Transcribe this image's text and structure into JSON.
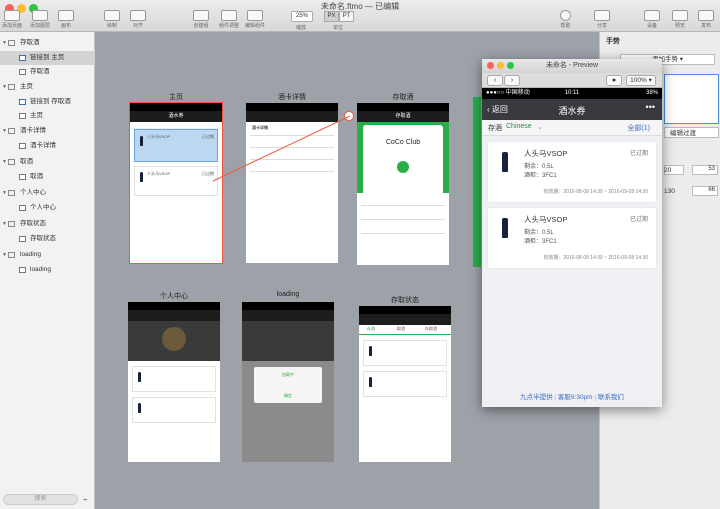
{
  "window": {
    "title": "未命名.ftmo — 已编辑"
  },
  "toolbar": {
    "items": [
      "添加页面",
      "添加图层",
      "画布",
      "绘制",
      "对齐",
      "创建组",
      "组件调整",
      "编辑组件",
      "25%",
      "缩放",
      "PX",
      "PT",
      "单位",
      "帮助",
      "分享",
      "设备",
      "预览",
      "发布"
    ]
  },
  "sidebar": {
    "search_placeholder": "搜索",
    "groups": [
      {
        "label": "存取酒",
        "items": [
          "链接到 主页",
          "存取酒"
        ]
      },
      {
        "label": "主页",
        "items": [
          "链接到 存取酒",
          "主页"
        ]
      },
      {
        "label": "酒卡详情",
        "items": [
          "酒卡详情"
        ]
      },
      {
        "label": "取酒",
        "items": [
          "取酒"
        ]
      },
      {
        "label": "个人中心",
        "items": [
          "个人中心"
        ]
      },
      {
        "label": "存取状态",
        "items": [
          "存取状态"
        ]
      },
      {
        "label": "loading",
        "items": [
          "loading"
        ]
      }
    ]
  },
  "inspector": {
    "title": "手势",
    "add_label": "添加手势",
    "edit_label": "编辑过渡",
    "x": "20",
    "y": "53",
    "w": "130",
    "h": "66"
  },
  "artboards": [
    {
      "label": "主页"
    },
    {
      "label": "酒卡详情"
    },
    {
      "label": "存取酒"
    },
    {
      "label": "个人中心"
    },
    {
      "label": "loading"
    },
    {
      "label": "存取状态"
    }
  ],
  "mini": {
    "home_nav": "酒水券",
    "detail_title": "酒卡详情",
    "club": "CoCo Club",
    "store_nav": "存取酒",
    "card_name": "人头马VSOP",
    "card_exp": "已过期",
    "loading_msg": "加载中",
    "confirm": "确定",
    "status_tabs": [
      "存酒",
      "取酒",
      "存取酒"
    ]
  },
  "preview": {
    "title": "未命名 - Preview",
    "zoom": "100%",
    "carrier": "●●●○○ 中国移动",
    "time": "10:11",
    "battery": "38%",
    "back": "返回",
    "nav_title": "酒水券",
    "tab_store": "存酒",
    "tab_store_sub": "Chinese",
    "tab_all": "全部(1)",
    "edit": "编辑过渡",
    "cards": [
      {
        "name": "人头马VSOP",
        "status": "已过期",
        "remain": "剩余：0.5L",
        "code": "酒柜：3FC1",
        "validity": "有效期：2016-08-08 14:30 ~ 2016-09-08 14:30"
      },
      {
        "name": "人头马VSOP",
        "status": "已过期",
        "remain": "剩余：0.5L",
        "code": "酒柜：3FC1",
        "validity": "有效期：2016-08-08 14:30 ~ 2016-09-08 14:30"
      }
    ],
    "footer": [
      "九点半提供",
      "客服9:30pm",
      "联系我们"
    ]
  },
  "colors": {
    "accent": "#2aae4a",
    "nav": "#393a3f",
    "link": "#3b6ec1",
    "selection": "#f0563e"
  }
}
